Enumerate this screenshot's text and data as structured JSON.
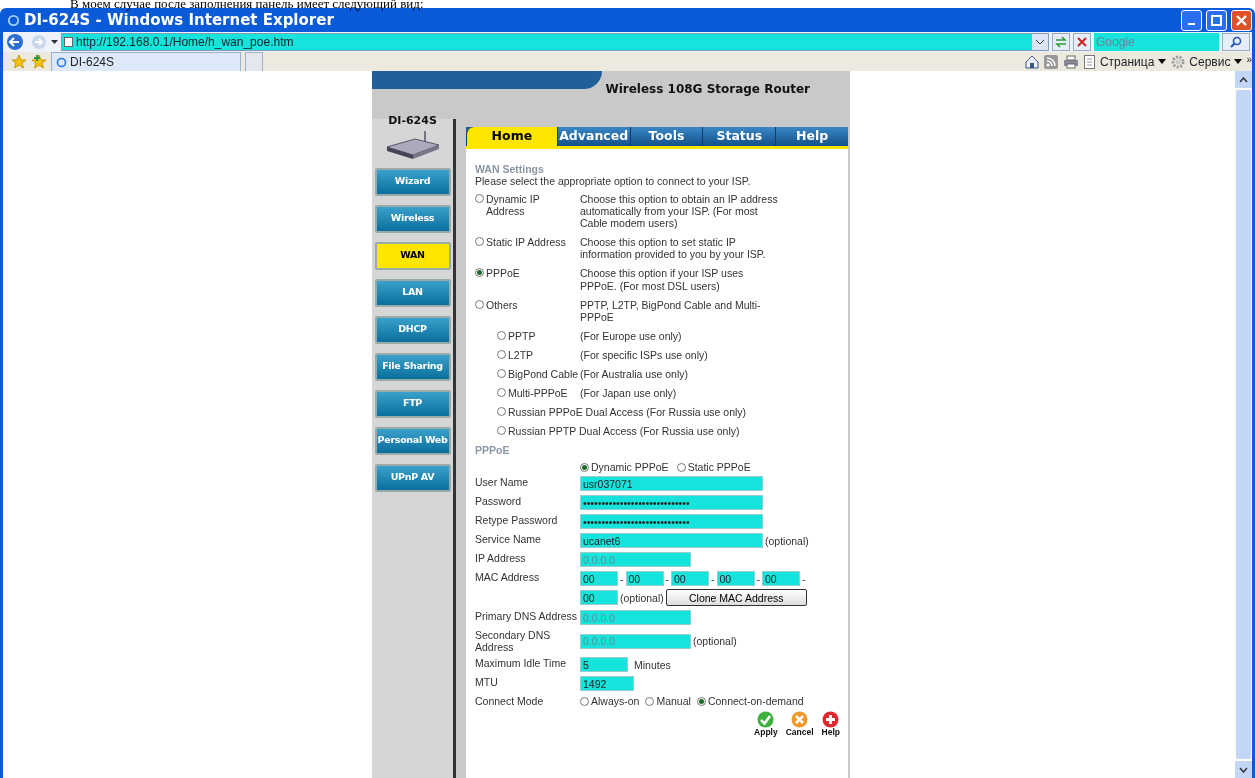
{
  "caption": "В моем случае после заполнения панель имеет следующий вид:",
  "window": {
    "title": "DI-624S - Windows Internet Explorer"
  },
  "address_bar": {
    "url": "http://192.168.0.1/Home/h_wan_poe.htm"
  },
  "search": {
    "placeholder": "Google"
  },
  "tabs": [
    {
      "label": "DI-624S",
      "selected": true
    }
  ],
  "overflow_chevron": "»",
  "command_bar": [
    {
      "kind": "page",
      "label": "Страница"
    },
    {
      "kind": "tools",
      "label": "Сервис"
    }
  ],
  "router": {
    "model": "DI-624S",
    "subtitle": "Wireless 108G Storage Router",
    "sidebar": [
      {
        "label": "Wizard",
        "selected": false
      },
      {
        "label": "Wireless",
        "selected": false
      },
      {
        "label": "WAN",
        "selected": true
      },
      {
        "label": "LAN",
        "selected": false
      },
      {
        "label": "DHCP",
        "selected": false
      },
      {
        "label": "File Sharing",
        "selected": false
      },
      {
        "label": "FTP",
        "selected": false
      },
      {
        "label": "Personal Web",
        "selected": false
      },
      {
        "label": "UPnP AV",
        "selected": false
      }
    ],
    "tabs": [
      {
        "label": "Home",
        "selected": true
      },
      {
        "label": "Advanced",
        "selected": false
      },
      {
        "label": "Tools",
        "selected": false
      },
      {
        "label": "Status",
        "selected": false
      },
      {
        "label": "Help",
        "selected": false
      }
    ],
    "section_title": "WAN Settings",
    "intro": "Please select the appropriate option to connect to your ISP.",
    "connection_types": [
      {
        "label": "Dynamic IP Address",
        "description": "Choose this option to obtain an IP address automatically from your ISP. (For most Cable modem users)",
        "selected": false
      },
      {
        "label": "Static IP Address",
        "description": "Choose this option to set static IP information provided to you by your ISP.",
        "selected": false
      },
      {
        "label": "PPPoE",
        "description": "Choose this option if your ISP uses PPPoE. (For most DSL users)",
        "selected": true
      },
      {
        "label": "Others",
        "description": "PPTP, L2TP, BigPond Cable and Multi-PPPoE",
        "selected": false,
        "children": [
          {
            "label": "PPTP",
            "description": "(For Europe use only)",
            "selected": false
          },
          {
            "label": "L2TP",
            "description": "(For specific ISPs use only)",
            "selected": false
          },
          {
            "label": "BigPond Cable",
            "description": "(For Australia use only)",
            "selected": false
          },
          {
            "label": "Multi-PPPoE",
            "description": "(For Japan use only)",
            "selected": false
          },
          {
            "label": "Russian PPPoE Dual Access (For Russia use only)",
            "selected": false
          },
          {
            "label": "Russian PPTP Dual Access (For Russia use only)",
            "selected": false
          }
        ]
      }
    ],
    "pppoe": {
      "title": "PPPoE",
      "modes": [
        {
          "label": "Dynamic PPPoE",
          "selected": true
        },
        {
          "label": "Static PPPoE",
          "selected": false
        }
      ],
      "fields": [
        {
          "kind": "text",
          "label": "User Name",
          "value": "usr037071"
        },
        {
          "kind": "text",
          "label": "Password",
          "value": "•••••••••••••••••••••••••••••"
        },
        {
          "kind": "text",
          "label": "Retype Password",
          "value": "•••••••••••••••••••••••••••••"
        },
        {
          "kind": "text",
          "label": "Service Name",
          "value": "ucanet6",
          "note": "(optional)"
        },
        {
          "kind": "ip",
          "label": "IP Address",
          "value": "0.0.0.0",
          "disabled": true
        },
        {
          "kind": "mac",
          "label": "MAC Address",
          "octets": [
            "00",
            "00",
            "00",
            "00",
            "00",
            "00"
          ],
          "separator": "-",
          "note": "(optional)",
          "button": "Clone MAC Address"
        },
        {
          "kind": "ip",
          "label": "Primary DNS Address",
          "value": "0.0.0.0",
          "disabled": true
        },
        {
          "kind": "ip",
          "label": "Secondary DNS Address",
          "value": "0.0.0.0",
          "note": "(optional)",
          "disabled": true
        },
        {
          "kind": "short",
          "label": "Maximum Idle Time",
          "value": "5",
          "unit": "Minutes"
        },
        {
          "kind": "short",
          "label": "MTU",
          "value": "1492"
        },
        {
          "kind": "radio",
          "label": "Connect Mode",
          "options": [
            {
              "label": "Always-on",
              "selected": false
            },
            {
              "label": "Manual",
              "selected": false
            },
            {
              "label": "Connect-on-demand",
              "selected": true
            }
          ]
        }
      ]
    },
    "actions": [
      {
        "kind": "apply",
        "label": "Apply"
      },
      {
        "kind": "cancel",
        "label": "Cancel"
      },
      {
        "kind": "help",
        "label": "Help"
      }
    ]
  }
}
